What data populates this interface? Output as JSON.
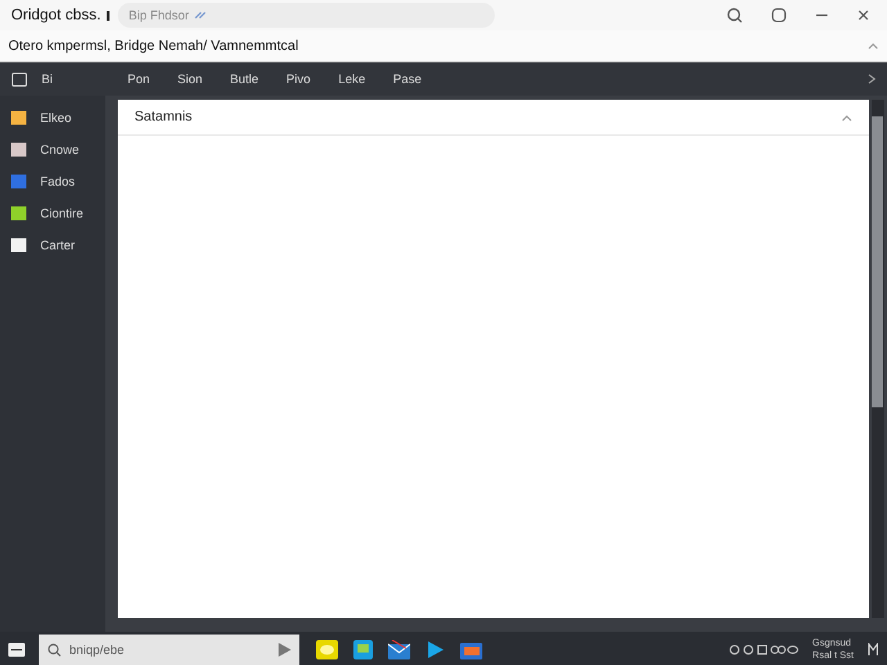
{
  "window": {
    "title": "Oridgot cbss.",
    "address": "Bip Fhdsor"
  },
  "breadcrumb": "Otero kmpermsl,  Bridge Nemah/ Vamnemmtcal",
  "menu": {
    "label": "Bi",
    "items": [
      {
        "label": "Pon",
        "selected": false
      },
      {
        "label": "Sion",
        "selected": false
      },
      {
        "label": "Butle",
        "selected": false
      },
      {
        "label": "Pivo",
        "selected": false
      },
      {
        "label": "Leke",
        "selected": false
      },
      {
        "label": "Pase",
        "selected": false
      }
    ]
  },
  "sidebar": {
    "items": [
      {
        "label": "Elkeo",
        "color": "#f5b342"
      },
      {
        "label": "Cnowe",
        "color": "#d8c8c8"
      },
      {
        "label": "Fados",
        "color": "#2f6fe0"
      },
      {
        "label": "Ciontire",
        "color": "#8fd12a"
      },
      {
        "label": "Carter",
        "color": "#f2f2f2"
      }
    ]
  },
  "panel": {
    "title": "Satamnis",
    "expanded": true
  },
  "taskbar": {
    "search": "bniqp/ebe",
    "tray_line_1": "Gsgnsud",
    "tray_line_2": "Rsal t  Sst"
  }
}
